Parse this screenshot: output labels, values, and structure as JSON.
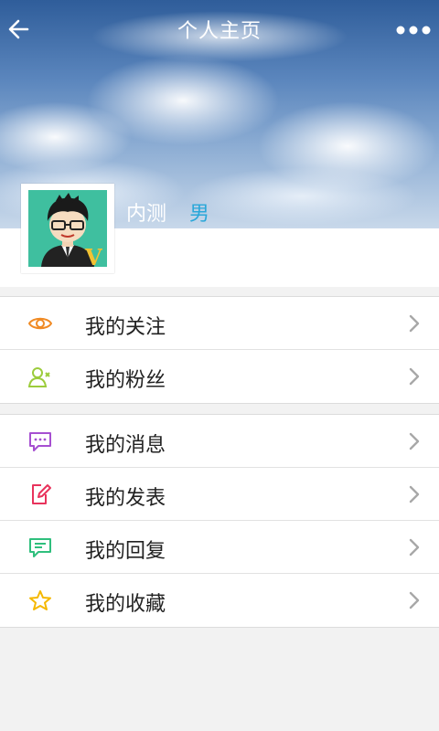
{
  "nav": {
    "title": "个人主页"
  },
  "profile": {
    "username": "内测",
    "gender": "男"
  },
  "menu_groups": [
    {
      "items": [
        {
          "label": "我的关注",
          "icon": "eye-icon",
          "color": "#f08a24"
        },
        {
          "label": "我的粉丝",
          "icon": "add-user-icon",
          "color": "#9ccc3c"
        }
      ]
    },
    {
      "items": [
        {
          "label": "我的消息",
          "icon": "message-icon",
          "color": "#a64fd1"
        },
        {
          "label": "我的发表",
          "icon": "edit-icon",
          "color": "#e8335c"
        },
        {
          "label": "我的回复",
          "icon": "reply-icon",
          "color": "#2fbf7d"
        },
        {
          "label": "我的收藏",
          "icon": "star-icon",
          "color": "#f5b800"
        }
      ]
    }
  ]
}
